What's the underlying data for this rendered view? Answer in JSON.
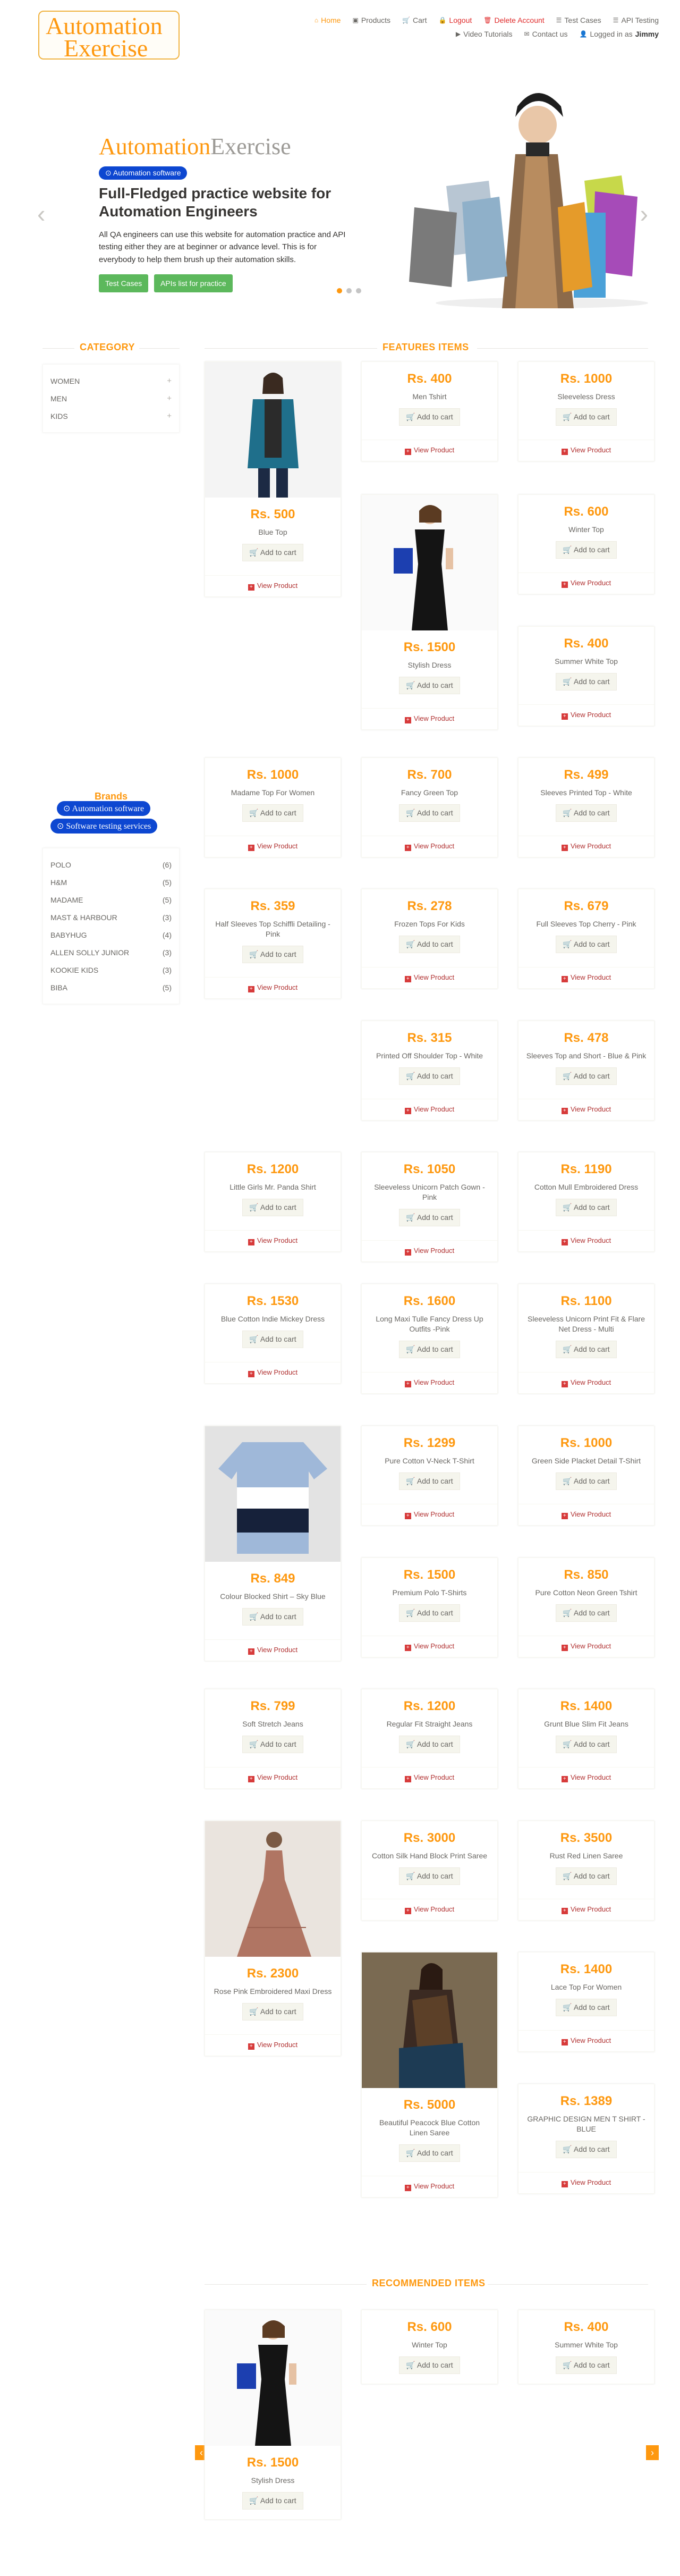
{
  "header": {
    "logo": {
      "l1a": "Automation",
      "l2a": "Exercise"
    },
    "nav": [
      {
        "icon": "home-icon",
        "glyph": "⌂",
        "label": "Home",
        "cls": "active"
      },
      {
        "icon": "products-icon",
        "glyph": "▣",
        "label": "Products",
        "cls": ""
      },
      {
        "icon": "cart-icon",
        "glyph": "🛒",
        "label": "Cart",
        "cls": ""
      },
      {
        "icon": "lock-icon",
        "glyph": "🔒",
        "label": "Logout",
        "cls": "red"
      },
      {
        "icon": "trash-icon",
        "glyph": "🗑",
        "label": "Delete Account",
        "cls": "red"
      },
      {
        "icon": "list-icon",
        "glyph": "☰",
        "label": "Test Cases",
        "cls": ""
      },
      {
        "icon": "list-icon",
        "glyph": "☰",
        "label": "API Testing",
        "cls": ""
      },
      {
        "icon": "video-icon",
        "glyph": "▶",
        "label": "Video Tutorials",
        "cls": ""
      },
      {
        "icon": "envelope-icon",
        "glyph": "✉",
        "label": "Contact us",
        "cls": ""
      }
    ],
    "logged_in_prefix": "Logged in as",
    "username": "Jimmy"
  },
  "slider": {
    "title_a": "Automation",
    "title_b": "Exercise",
    "pill": "Automation software",
    "heading": "Full-Fledged practice website for Automation Engineers",
    "paragraph": "All QA engineers can use this website for automation practice and API testing either they are at beginner or advance level. This is for everybody to help them brush up their automation skills.",
    "btn_test": "Test Cases",
    "btn_api": "APIs list for practice"
  },
  "sidebar": {
    "category_title": "Category",
    "categories": [
      "Women",
      "Men",
      "Kids"
    ],
    "brands_title": "Brands",
    "brand_pill1": "Automation software",
    "brand_pill2": "Software testing services",
    "brands": [
      {
        "name": "Polo",
        "count": "(6)"
      },
      {
        "name": "H&M",
        "count": "(5)"
      },
      {
        "name": "Madame",
        "count": "(5)"
      },
      {
        "name": "Mast & Harbour",
        "count": "(3)"
      },
      {
        "name": "Babyhug",
        "count": "(4)"
      },
      {
        "name": "Allen Solly Junior",
        "count": "(3)"
      },
      {
        "name": "Kookie Kids",
        "count": "(3)"
      },
      {
        "name": "Biba",
        "count": "(5)"
      }
    ]
  },
  "features_title": "Features Items",
  "recommended_title": "recommended items",
  "add_to_cart": "Add to cart",
  "view_product": "View Product",
  "colors": {
    "accent": "#fe980f",
    "pill": "#0d47d1",
    "green": "#5cb85c"
  },
  "products": [
    {
      "price": "Rs. 500",
      "name": "Blue Top",
      "img": "blue"
    },
    {
      "price": "Rs. 400",
      "name": "Men Tshirt",
      "img": ""
    },
    {
      "price": "Rs. 1000",
      "name": "Sleeveless Dress",
      "img": ""
    },
    {
      "price": "Rs. 1500",
      "name": "Stylish Dress",
      "img": "black"
    },
    {
      "price": "Rs. 600",
      "name": "Winter Top",
      "img": ""
    },
    {
      "price": "Rs. 400",
      "name": "Summer White Top",
      "img": ""
    },
    {
      "price": "Rs. 1000",
      "name": "Madame Top For Women",
      "img": ""
    },
    {
      "price": "Rs. 700",
      "name": "Fancy Green Top",
      "img": ""
    },
    {
      "price": "Rs. 499",
      "name": "Sleeves Printed Top - White",
      "img": ""
    },
    {
      "price": "Rs. 359",
      "name": "Half Sleeves Top Schiffli Detailing - Pink",
      "img": ""
    },
    {
      "price": "Rs. 278",
      "name": "Frozen Tops For Kids",
      "img": ""
    },
    {
      "price": "Rs. 679",
      "name": "Full Sleeves Top Cherry - Pink",
      "img": ""
    },
    {
      "price": "Rs. 315",
      "name": "Printed Off Shoulder Top - White",
      "img": ""
    },
    {
      "price": "Rs. 478",
      "name": "Sleeves Top and Short - Blue & Pink",
      "img": ""
    },
    {
      "price": "Rs. 1200",
      "name": "Little Girls Mr. Panda Shirt",
      "img": ""
    },
    {
      "price": "Rs. 1050",
      "name": "Sleeveless Unicorn Patch Gown - Pink",
      "img": ""
    },
    {
      "price": "Rs. 1190",
      "name": "Cotton Mull Embroidered Dress",
      "img": ""
    },
    {
      "price": "Rs. 1530",
      "name": "Blue Cotton Indie Mickey Dress",
      "img": ""
    },
    {
      "price": "Rs. 1600",
      "name": "Long Maxi Tulle Fancy Dress Up Outfits -Pink",
      "img": ""
    },
    {
      "price": "Rs. 1100",
      "name": "Sleeveless Unicorn Print Fit & Flare Net Dress - Multi",
      "img": ""
    },
    {
      "price": "Rs. 849",
      "name": "Colour Blocked Shirt – Sky Blue",
      "img": "shirt"
    },
    {
      "price": "Rs. 1299",
      "name": "Pure Cotton V-Neck T-Shirt",
      "img": ""
    },
    {
      "price": "Rs. 1000",
      "name": "Green Side Placket Detail T-Shirt",
      "img": ""
    },
    {
      "price": "Rs. 1500",
      "name": "Premium Polo T-Shirts",
      "img": ""
    },
    {
      "price": "Rs. 850",
      "name": "Pure Cotton Neon Green Tshirt",
      "img": ""
    },
    {
      "price": "Rs. 799",
      "name": "Soft Stretch Jeans",
      "img": ""
    },
    {
      "price": "Rs. 1200",
      "name": "Regular Fit Straight Jeans",
      "img": ""
    },
    {
      "price": "Rs. 1400",
      "name": "Grunt Blue Slim Fit Jeans",
      "img": ""
    },
    {
      "price": "Rs. 2300",
      "name": "Rose Pink Embroidered Maxi Dress",
      "img": "maxi"
    },
    {
      "price": "Rs. 3000",
      "name": "Cotton Silk Hand Block Print Saree",
      "img": ""
    },
    {
      "price": "Rs. 3500",
      "name": "Rust Red Linen Saree",
      "img": ""
    },
    {
      "price": "Rs. 5000",
      "name": "Beautiful Peacock Blue Cotton Linen Saree",
      "img": "saree"
    },
    {
      "price": "Rs. 1400",
      "name": "Lace Top For Women",
      "img": ""
    },
    {
      "price": "Rs. 1389",
      "name": "GRAPHIC DESIGN MEN T SHIRT - BLUE",
      "img": ""
    }
  ],
  "recommended": [
    {
      "price": "Rs. 1500",
      "name": "Stylish Dress",
      "img": "black"
    },
    {
      "price": "Rs. 600",
      "name": "Winter Top",
      "img": ""
    },
    {
      "price": "Rs. 400",
      "name": "Summer White Top",
      "img": ""
    }
  ]
}
